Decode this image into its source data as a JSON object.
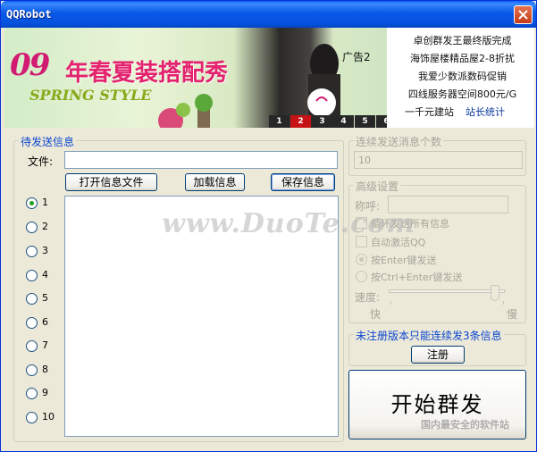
{
  "window": {
    "title": "QQRobot"
  },
  "banner": {
    "ad_label": "广告2",
    "tabs": [
      "1",
      "2",
      "3",
      "4",
      "5",
      "6"
    ],
    "links": [
      "卓创群发王最终版完成",
      "海饰屋楼精品屋2-8折扰",
      "我爱少数派数码促销",
      "四线服务器空间800元/G",
      "一千元建站"
    ],
    "stat_link": "站长统计"
  },
  "send": {
    "group_title": "待发送信息",
    "file_label": "文件:",
    "file_value": "",
    "open_button": "打开信息文件",
    "load_button": "加载信息",
    "save_button": "保存信息",
    "slots": [
      "1",
      "2",
      "3",
      "4",
      "5",
      "6",
      "7",
      "8",
      "9",
      "10"
    ],
    "selected_slot": "1"
  },
  "count": {
    "group_title": "连续发送消息个数",
    "value": "10"
  },
  "advanced": {
    "group_title": "高级设置",
    "nickname_label": "称呼:",
    "loop_label": "循环发送所有信息",
    "auto_qq_label": "自动激活QQ",
    "enter_label": "按Enter键发送",
    "ctrl_enter_label": "按Ctrl+Enter键发送",
    "speed_label": "速度:",
    "fast_label": "快",
    "slow_label": "慢",
    "speed_value": 0.95
  },
  "register": {
    "notice": "未注册版本只能连续发3条信息",
    "button": "注册"
  },
  "start_button": "开始群发"
}
